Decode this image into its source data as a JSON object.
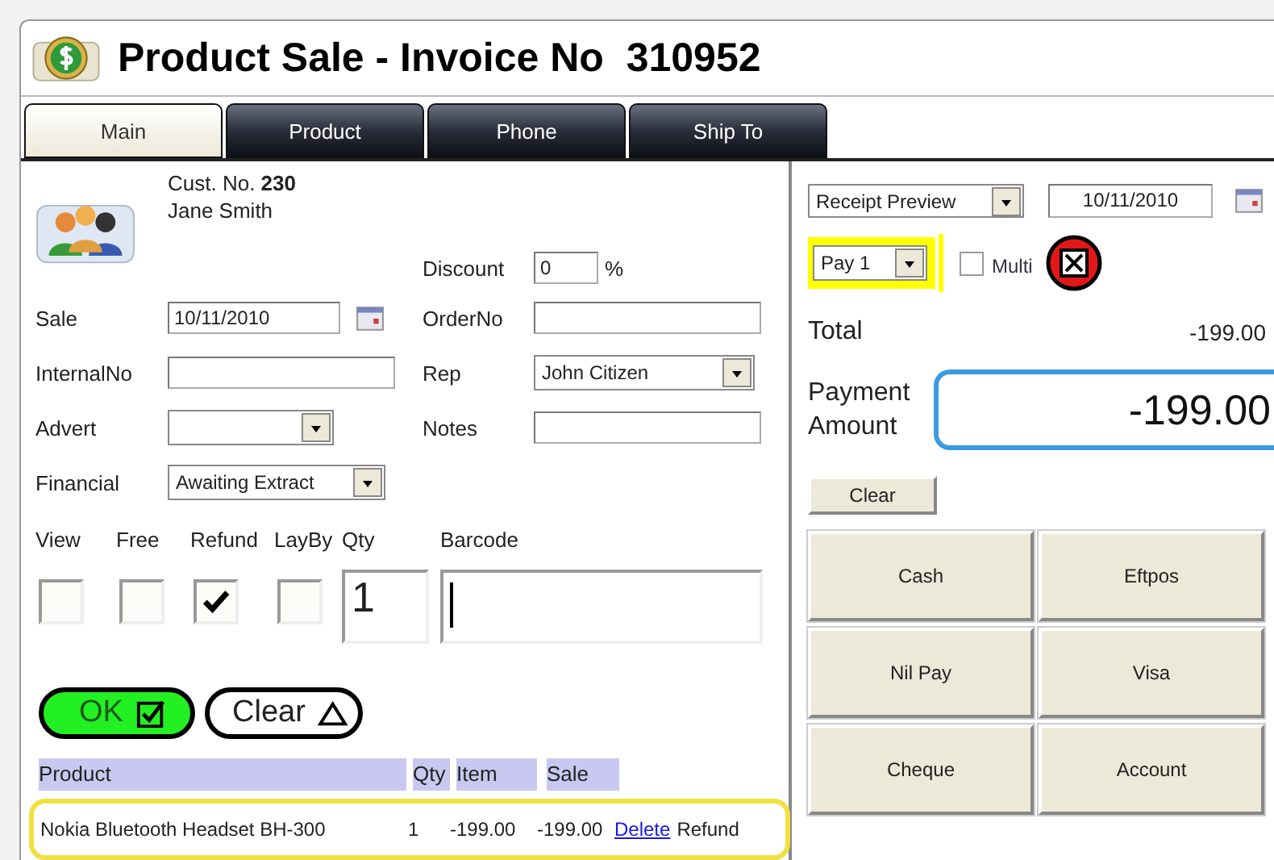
{
  "window": {
    "title": "Product Sale - Invoice No  310952"
  },
  "tabs": [
    {
      "label": "Main",
      "selected": true
    },
    {
      "label": "Product",
      "selected": false
    },
    {
      "label": "Phone",
      "selected": false
    },
    {
      "label": "Ship To",
      "selected": false
    }
  ],
  "customer": {
    "number": "Cust. No. **230**",
    "name": "Jane Smith"
  },
  "discount": {
    "label": "Discount",
    "value": "0",
    "unit": "%"
  },
  "fields_left": [
    {
      "label": "Sale",
      "kind": "date",
      "value": "10/11/2010"
    },
    {
      "label": "InternalNo",
      "kind": "text"
    },
    {
      "label": "Advert",
      "kind": "select"
    },
    {
      "label": "Financial",
      "kind": "select",
      "value": "Awaiting Extract"
    }
  ],
  "fields_right": [
    {
      "label": "OrderNo",
      "kind": "text"
    },
    {
      "label": "Rep",
      "kind": "select",
      "value": "John Citizen"
    },
    {
      "label": "Notes",
      "kind": "text"
    }
  ],
  "flags": [
    {
      "label": "View",
      "checked": false
    },
    {
      "label": "Free",
      "checked": false
    },
    {
      "label": "Refund",
      "checked": true
    },
    {
      "label": "LayBy",
      "checked": false
    }
  ],
  "qty": {
    "label": "Qty",
    "value": "1"
  },
  "barcode": {
    "label": "Barcode"
  },
  "actions": [
    {
      "label": "OK",
      "kind": "ok"
    },
    {
      "label": "Clear",
      "kind": "clear"
    }
  ],
  "table": {
    "columns": [
      "Product",
      "Qty",
      "Item",
      "Sale"
    ],
    "rows": [
      {
        "product": "Nokia Bluetooth Headset BH-300",
        "qty": "1",
        "item": "-199.00",
        "sale": "-199.00",
        "link": "Delete",
        "note": "Refund"
      }
    ]
  },
  "receipt": {
    "value": "Receipt Preview",
    "date": "10/11/2010"
  },
  "pay": {
    "value": "Pay 1",
    "highlighted": true
  },
  "multi": {
    "label": "Multi",
    "checked": false
  },
  "total": {
    "label": "Total",
    "value": "-199.00"
  },
  "payment": {
    "label": "Payment Amount",
    "value": "-199.00"
  },
  "clear_button": "Clear",
  "pay_methods": [
    "Cash",
    "Eftpos",
    "Nil Pay",
    "Visa",
    "Cheque",
    "Account"
  ]
}
